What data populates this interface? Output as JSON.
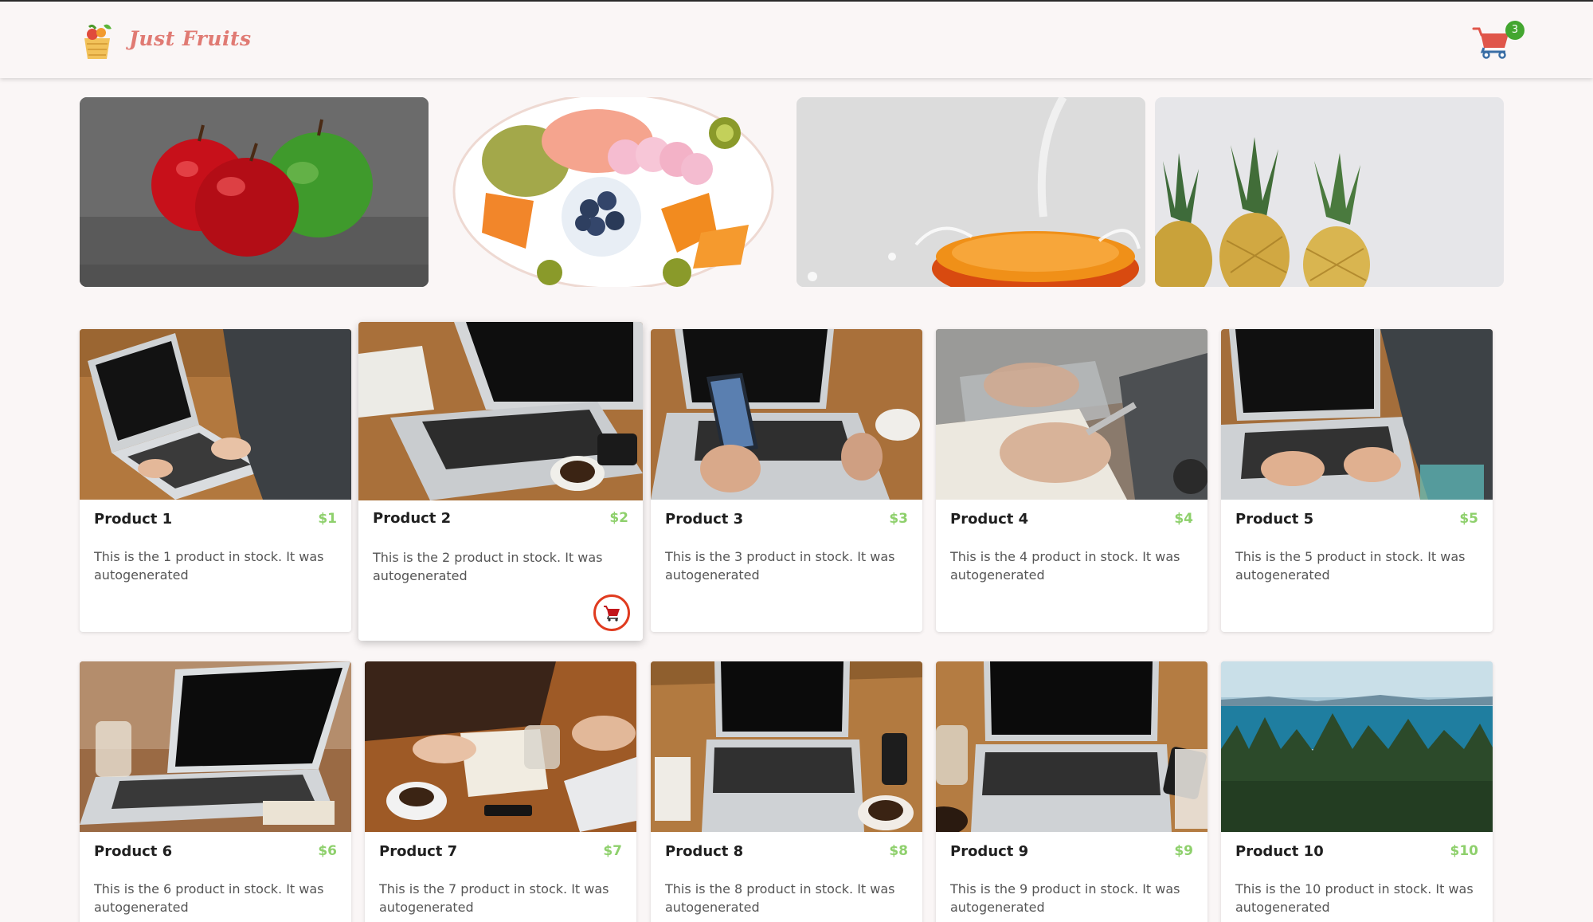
{
  "header": {
    "brand": "Just Fruits",
    "cart_count": "3"
  },
  "banners": [
    {
      "subject": "red and green apples"
    },
    {
      "subject": "fruit platter"
    },
    {
      "subject": "orange splash"
    },
    {
      "subject": "pineapples"
    }
  ],
  "products": [
    {
      "name": "Product 1",
      "price": "$1",
      "description": "This is the 1 product in stock. It was autogenerated"
    },
    {
      "name": "Product 2",
      "price": "$2",
      "description": "This is the 2 product in stock. It was autogenerated"
    },
    {
      "name": "Product 3",
      "price": "$3",
      "description": "This is the 3 product in stock. It was autogenerated"
    },
    {
      "name": "Product 4",
      "price": "$4",
      "description": "This is the 4 product in stock. It was autogenerated"
    },
    {
      "name": "Product 5",
      "price": "$5",
      "description": "This is the 5 product in stock. It was autogenerated"
    },
    {
      "name": "Product 6",
      "price": "$6",
      "description": "This is the 6 product in stock. It was autogenerated"
    },
    {
      "name": "Product 7",
      "price": "$7",
      "description": "This is the 7 product in stock. It was autogenerated"
    },
    {
      "name": "Product 8",
      "price": "$8",
      "description": "This is the 8 product in stock. It was autogenerated"
    },
    {
      "name": "Product 9",
      "price": "$9",
      "description": "This is the 9 product in stock. It was autogenerated"
    },
    {
      "name": "Product 10",
      "price": "$10",
      "description": "This is the 10 product in stock. It was autogenerated"
    }
  ],
  "colors": {
    "background": "#faf6f6",
    "brand": "#e07a73",
    "price": "#8ed06c",
    "cart_badge": "#43a630",
    "add_cart_ring": "#e03b1f"
  },
  "icons": {
    "logo": "fruit-basket-icon",
    "cart": "shopping-cart-icon",
    "add_to_cart": "add-to-cart-icon"
  }
}
